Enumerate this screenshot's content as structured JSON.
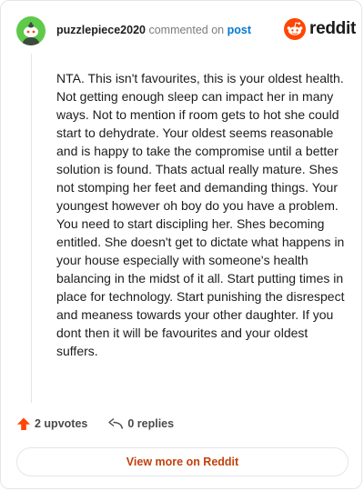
{
  "header": {
    "username": "puzzlepiece2020",
    "action": "commented on",
    "target": "post"
  },
  "brand": {
    "wordmark": "reddit",
    "icon": "reddit-alien-logo",
    "color": "#ff4500"
  },
  "avatar": {
    "icon": "snoo-avatar",
    "background": "#5ec94a"
  },
  "comment": {
    "text": "NTA. This isn't favourites, this is your oldest health. Not getting enough sleep can impact her in many ways. Not to mention if room gets to hot she could start to dehydrate. Your oldest seems reasonable and is happy to take the compromise until a better solution is found. Thats actual really mature. Shes not stomping her feet and demanding things. Your youngest however oh boy do you have a problem. You need to start discipling her. Shes becoming entitled. She doesn't get to dictate what happens in your house especially with someone's health balancing in the midst of it all. Start putting times in place for technology. Start punishing the disrespect and meaness towards your other daughter. If you dont then it will be favourites and your oldest suffers."
  },
  "footer": {
    "upvotes": "2 upvotes",
    "upvote_icon": "upvote-arrow-icon",
    "replies": "0 replies",
    "reply_icon": "reply-arrow-icon",
    "upvote_color": "#ff4500"
  },
  "cta": {
    "label": "View more on Reddit",
    "color": "#c2410c"
  }
}
